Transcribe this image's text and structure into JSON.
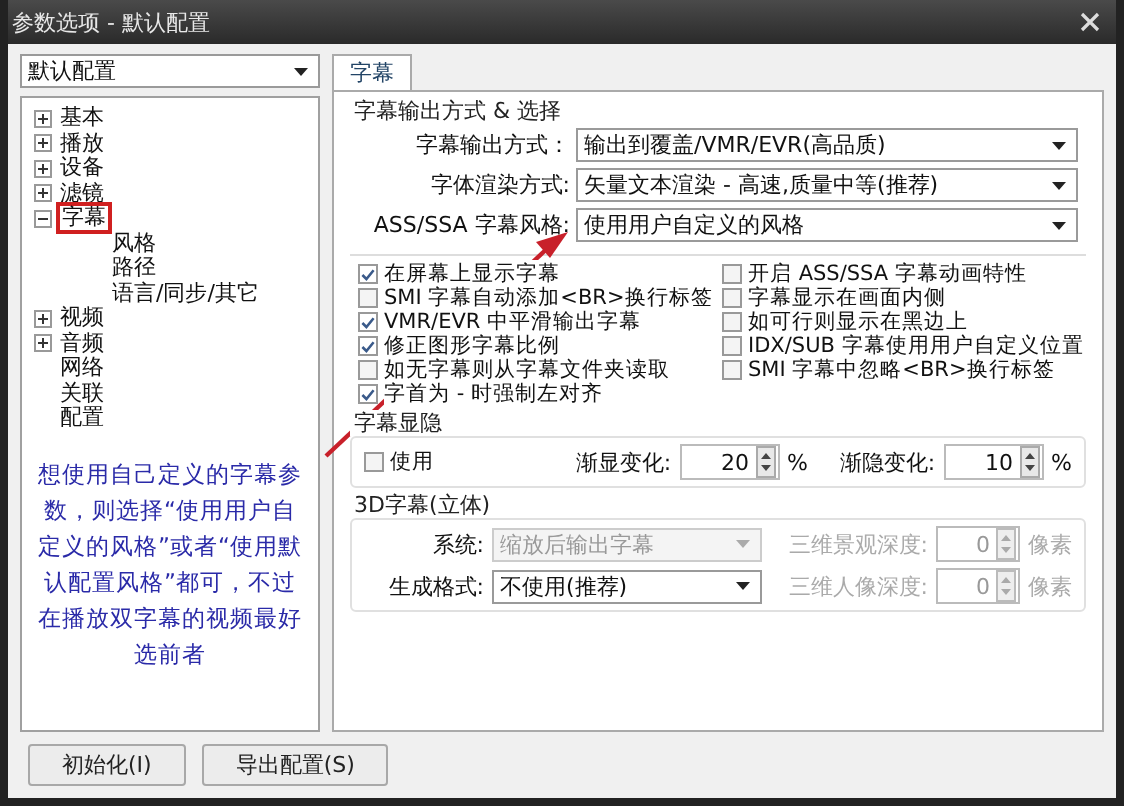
{
  "window": {
    "title": "参数选项 - 默认配置"
  },
  "profile_select": {
    "value": "默认配置"
  },
  "tree": [
    {
      "label": "基本",
      "expanded": false,
      "marked": false
    },
    {
      "label": "播放",
      "expanded": false,
      "marked": false
    },
    {
      "label": "设备",
      "expanded": false,
      "marked": false
    },
    {
      "label": "滤镜",
      "expanded": false,
      "marked": false
    },
    {
      "label": "字幕",
      "expanded": true,
      "marked": true,
      "children": [
        {
          "label": "风格",
          "marked": false
        },
        {
          "label": "路径",
          "marked": false
        },
        {
          "label": "语言/同步/其它",
          "marked": false
        }
      ]
    },
    {
      "label": "视频",
      "expanded": false,
      "marked": false
    },
    {
      "label": "音频",
      "expanded": false,
      "marked": false
    },
    {
      "label": "网络",
      "marked": false
    },
    {
      "label": "关联",
      "marked": false
    },
    {
      "label": "配置",
      "marked": false
    }
  ],
  "help_text": "想使用自己定义的字幕参数，则选择“使用用户自定义的风格”或者“使用默认配置风格”都可，不过在播放双字幕的视频最好选前者",
  "tabs": [
    {
      "label": "字幕",
      "selected": true
    }
  ],
  "output_group": {
    "title": "字幕输出方式 & 选择",
    "fields": [
      {
        "label": "字幕输出方式：",
        "value": "输出到覆盖/VMR/EVR(高品质)"
      },
      {
        "label": "字体渲染方式:",
        "value": "矢量文本渲染 - 高速,质量中等(推荐)"
      },
      {
        "label": "ASS/SSA 字幕风格:",
        "value": "使用用户自定义的风格"
      }
    ],
    "options": [
      {
        "label": "在屏幕上显示字幕",
        "checked": true
      },
      {
        "label": "开启 ASS/SSA 字幕动画特性",
        "checked": false
      },
      {
        "label": "SMI 字幕自动添加<BR>换行标签",
        "checked": false
      },
      {
        "label": "字幕显示在画面内侧",
        "checked": false
      },
      {
        "label": "VMR/EVR 中平滑输出字幕",
        "checked": true
      },
      {
        "label": "如可行则显示在黑边上",
        "checked": false
      },
      {
        "label": "修正图形字幕比例",
        "checked": true
      },
      {
        "label": "IDX/SUB 字幕使用用户自定义位置",
        "checked": false
      },
      {
        "label": "如无字幕则从字幕文件夹读取",
        "checked": false
      },
      {
        "label": "SMI 字幕中忽略<BR>换行标签",
        "checked": false
      },
      {
        "label": "字首为 - 时强制左对齐",
        "checked": true
      }
    ]
  },
  "fade_group": {
    "title": "字幕显隐",
    "use": {
      "label": "使用",
      "checked": false
    },
    "spinners": [
      {
        "label": "渐显变化:",
        "value": "20",
        "unit": "%"
      },
      {
        "label": "渐隐变化:",
        "value": "10",
        "unit": "%"
      }
    ]
  },
  "stereo_group": {
    "title": "3D字幕(立体)",
    "rows": [
      {
        "label": "系统:",
        "value": "缩放后输出字幕",
        "disabled": true,
        "depth_label": "三维景观深度:",
        "depth_value": "0",
        "depth_unit": "像素",
        "depth_disabled": true
      },
      {
        "label": "生成格式:",
        "value": "不使用(推荐)",
        "disabled": false,
        "depth_label": "三维人像深度:",
        "depth_value": "0",
        "depth_unit": "像素",
        "depth_disabled": true
      }
    ]
  },
  "buttons": [
    {
      "label": "初始化(I)"
    },
    {
      "label": "导出配置(S)"
    }
  ]
}
